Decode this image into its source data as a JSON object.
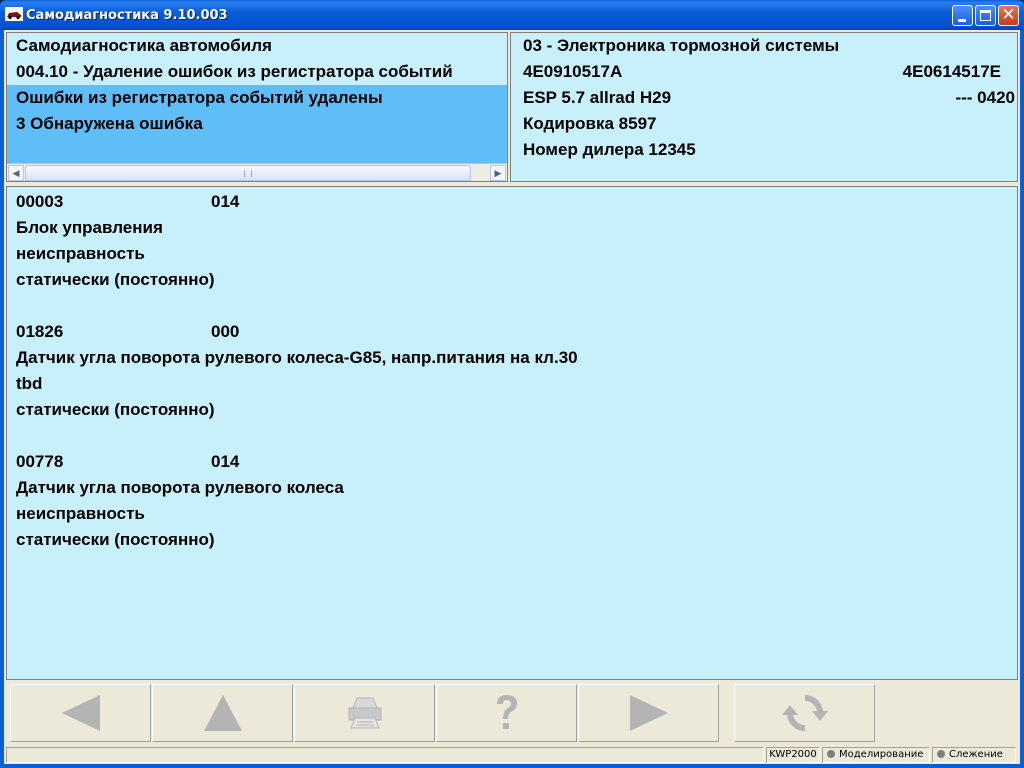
{
  "window": {
    "title": "Самодиагностика 9.10.003"
  },
  "left_panel": {
    "line1": "Самодиагностика автомобиля",
    "line2": "004.10 - Удаление ошибок из регистратора событий",
    "line3": "Ошибки из регистратора событий удалены",
    "line4": "3 Обнаружена ошибка"
  },
  "right_panel": {
    "system": "03 - Электроника тормозной системы",
    "part_number": "4E0910517A",
    "part_number_right": "4E0614517E",
    "component": "ESP 5.7 allrad  H29",
    "version": "---  0420",
    "coding": "Кодировка 8597",
    "dealer": "Номер дилера 12345"
  },
  "faults": [
    {
      "code": "00003",
      "subcode": "014",
      "description": "Блок управления",
      "type": "неисправность",
      "status": "статически (постоянно)"
    },
    {
      "code": "01826",
      "subcode": "000",
      "description": "Датчик угла поворота рулевого колеса-G85, напр.питания на кл.30",
      "type": "tbd",
      "status": "статически (постоянно)"
    },
    {
      "code": "00778",
      "subcode": "014",
      "description": "Датчик угла поворота рулевого колеса",
      "type": "неисправность",
      "status": "статически (постоянно)"
    }
  ],
  "statusbar": {
    "protocol": "KWP2000",
    "simulation": "Моделирование",
    "trace": "Слежение"
  },
  "colors": {
    "panel_bg": "#c8f0fb",
    "selection_bg": "#5fbef7",
    "disabled_icon": "#b4b4b4"
  }
}
